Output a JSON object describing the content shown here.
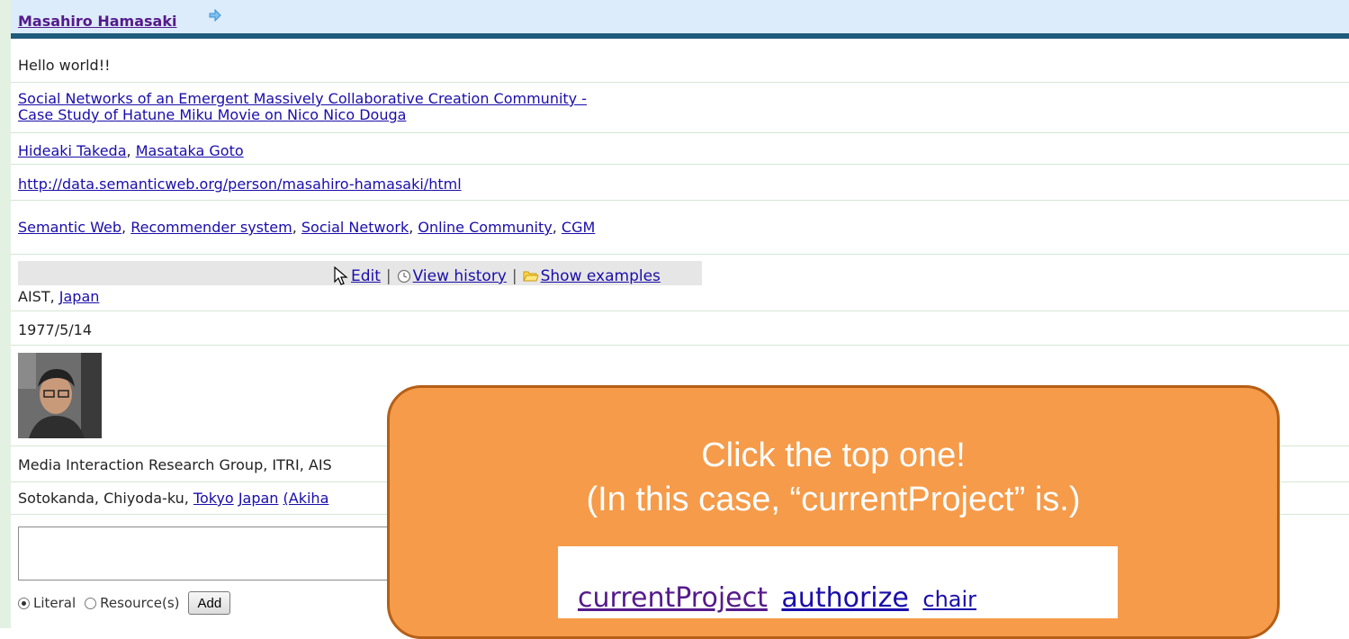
{
  "header": {
    "name": "Masahiro Hamasaki"
  },
  "rows": {
    "greeting": "Hello world!!",
    "paper_line1": "Social Networks of an Emergent Massively Collaborative Creation Community -",
    "paper_line2": "Case Study of Hatune Miku Movie on Nico Nico Douga",
    "coauthor1": "Hideaki Takeda",
    "comma": ",",
    "coauthor2": "Masataka Goto",
    "homepage": "http://data.semanticweb.org/person/masahiro-hamasaki/html",
    "interests": [
      "Semantic Web",
      "Recommender system",
      "Social Network",
      "Online Community",
      "CGM"
    ],
    "affiliation_prefix": "AIST,",
    "affiliation_link": "Japan",
    "birthday": "1977/5/14",
    "group": "Media Interaction Research Group, ITRI, AIS",
    "address_prefix": "Sotokanda, Chiyoda-ku,",
    "address_link1": "Tokyo",
    "address_link2": "Japan",
    "address_link3": "(Akiha"
  },
  "toolbar": {
    "edit": "Edit",
    "sep": "|",
    "history": "View history",
    "examples": "Show examples"
  },
  "form": {
    "literal": "Literal",
    "resource": "Resource(s)",
    "add": "Add"
  },
  "callout": {
    "line1": "Click the top one!",
    "line2": "(In this case, “currentProject” is.)",
    "link1": "currentProject",
    "link2": "authorize",
    "link3": "chair"
  },
  "colors": {
    "header_bg": "#dcecfa",
    "header_border": "#1f5b7a",
    "callout_bg": "#f59b4a",
    "callout_border": "#b55f17"
  }
}
